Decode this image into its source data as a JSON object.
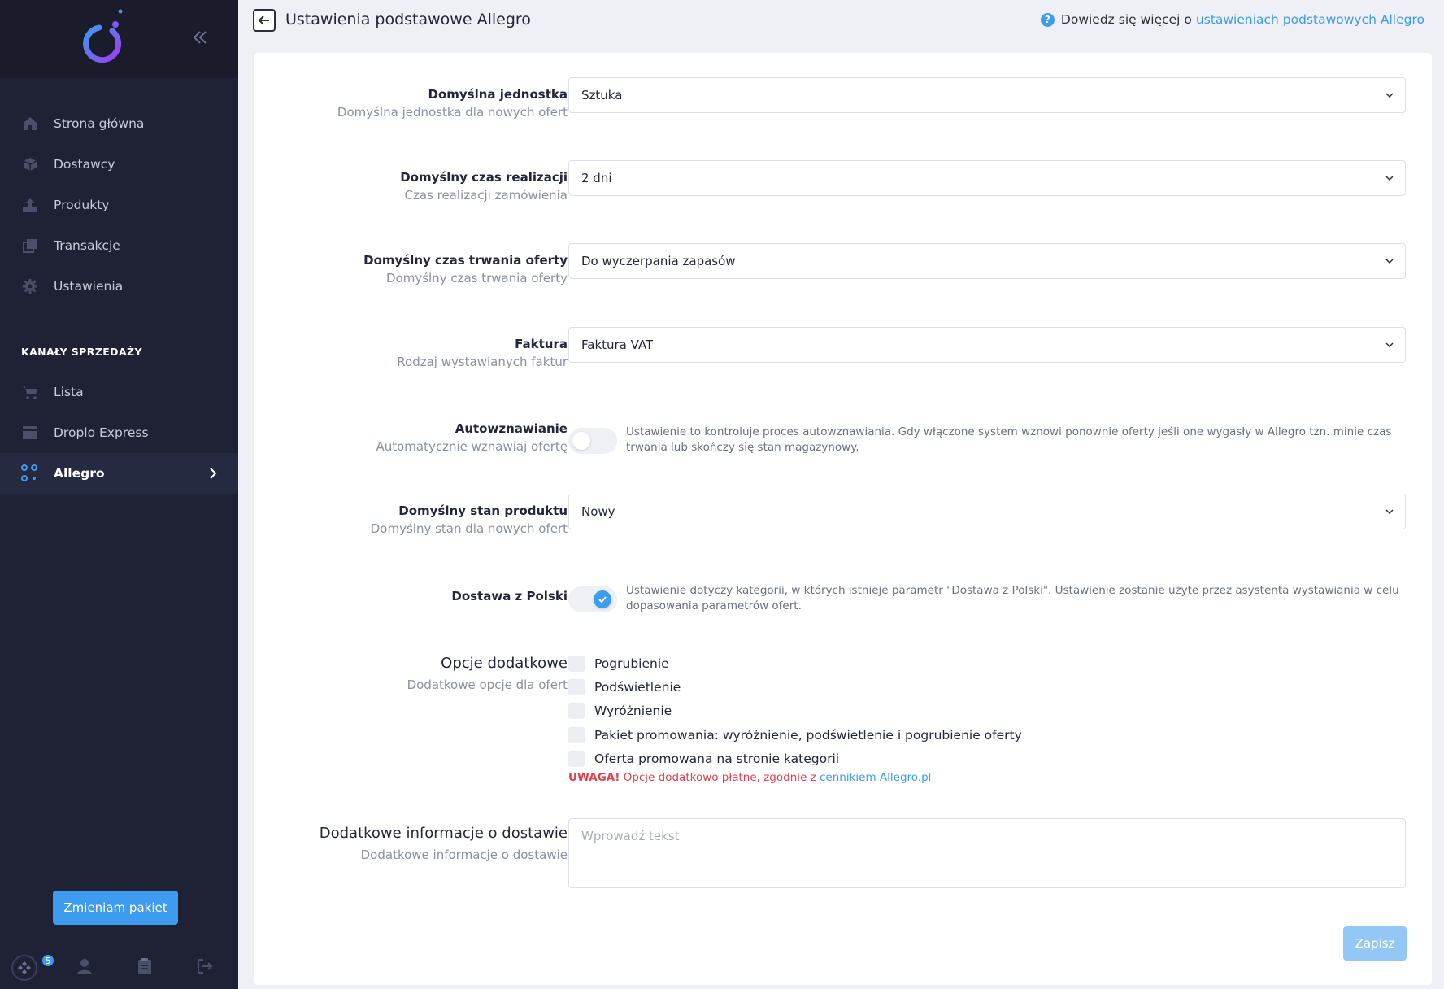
{
  "colors": {
    "accent": "#3d9bf0",
    "sidebar_bg": "#1f2235",
    "warning": "#e0424e"
  },
  "sidebar": {
    "logo": "droplo-logo",
    "collapse_icon": "double-chevron-left-icon",
    "items": [
      {
        "label": "Strona główna",
        "icon": "home-icon"
      },
      {
        "label": "Dostawcy",
        "icon": "box-icon"
      },
      {
        "label": "Produkty",
        "icon": "upload-icon"
      },
      {
        "label": "Transakcje",
        "icon": "copy-icon"
      },
      {
        "label": "Ustawienia",
        "icon": "gear-icon"
      }
    ],
    "section_label": "KANAŁY SPRZEDAŻY",
    "channels": [
      {
        "label": "Lista",
        "icon": "cart-icon"
      },
      {
        "label": "Droplo Express",
        "icon": "window-icon"
      },
      {
        "label": "Allegro",
        "icon": "allegro-icon",
        "active": true
      }
    ],
    "package_button": "Zmieniam pakiet",
    "bottom": {
      "badge_count": "5"
    }
  },
  "header": {
    "title": "Ustawienia podstawowe Allegro",
    "help_text": "Dowiedz się więcej o",
    "help_link": "ustawieniach podstawowych Allegro"
  },
  "form": {
    "unit": {
      "label": "Domyślna jednostka",
      "sub": "Domyślna jednostka dla nowych ofert",
      "value": "Sztuka"
    },
    "realization": {
      "label": "Domyślny czas realizacji",
      "sub": "Czas realizacji zamówienia",
      "value": "2 dni"
    },
    "duration": {
      "label": "Domyślny czas trwania oferty",
      "sub": "Domyślny czas trwania oferty",
      "value": "Do wyczerpania zapasów"
    },
    "invoice": {
      "label": "Faktura",
      "sub": "Rodzaj wystawianych faktur",
      "value": "Faktura VAT"
    },
    "autorenew": {
      "label": "Autowznawianie",
      "sub": "Automatycznie wznawiaj ofertę",
      "on": false,
      "desc": "Ustawienie to kontroluje proces autowznawiania. Gdy włączone system wznowi ponownie oferty jeśli one wygasły w Allegro tzn. minie czas trwania lub skończy się stan magazynowy."
    },
    "condition": {
      "label": "Domyślny stan produktu",
      "sub": "Domyślny stan dla nowych ofert",
      "value": "Nowy"
    },
    "poland": {
      "label": "Dostawa z Polski",
      "on": true,
      "desc": "Ustawienie dotyczy kategorii, w których istnieje parametr \"Dostawa z Polski\". Ustawienie zostanie użyte przez asystenta wystawiania w celu dopasowania parametrów ofert."
    },
    "options": {
      "label": "Opcje dodatkowe",
      "sub": "Dodatkowe opcje dla ofert",
      "items": [
        "Pogrubienie",
        "Podświetlenie",
        "Wyróżnienie",
        "Pakiet promowania: wyróżnienie, podświetlenie i pogrubienie oferty",
        "Oferta promowana na stronie kategorii"
      ],
      "warning_bold": "UWAGA!",
      "warning_text": "Opcje dodatkowo płatne, zgodnie z",
      "warning_link": "cennikiem Allegro.pl"
    },
    "delivery_info": {
      "label": "Dodatkowe informacje o dostawie",
      "sub": "Dodatkowe informacje o dostawie",
      "placeholder": "Wprowadź tekst",
      "value": ""
    },
    "save": "Zapisz"
  }
}
